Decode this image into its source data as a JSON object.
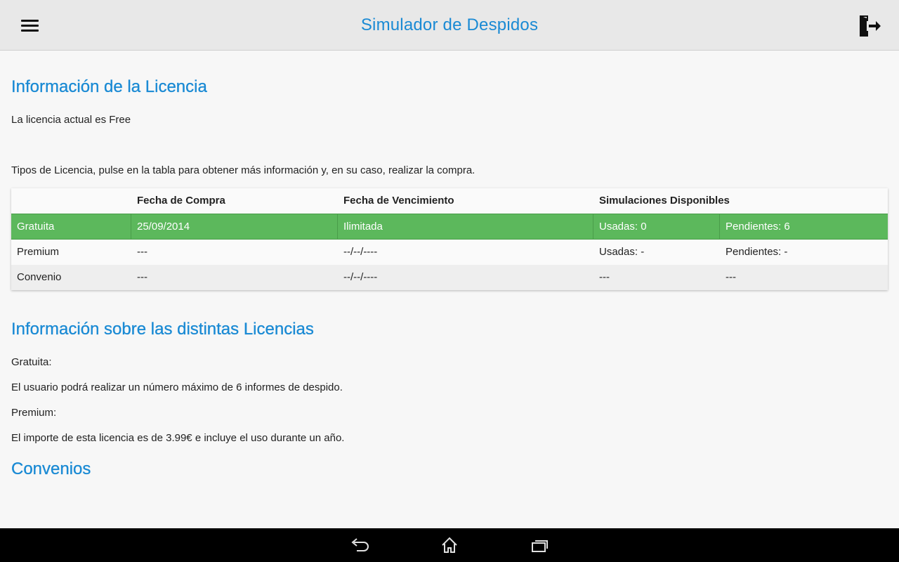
{
  "app": {
    "title": "Simulador de Despidos",
    "accent_color": "#1a8ad4",
    "menu_icon": "hamburger-menu-icon",
    "exit_icon": "exit-door-icon"
  },
  "license_info": {
    "heading": "Información de la Licencia",
    "current": "La licencia actual es Free",
    "instructions": "Tipos de Licencia, pulse en la tabla para obtener más información y, en su caso, realizar la compra."
  },
  "license_table": {
    "headers": [
      "",
      "Fecha de Compra",
      "Fecha de Vencimiento",
      "Simulaciones Disponibles",
      ""
    ],
    "rows": [
      {
        "name": "Gratuita",
        "purchase": "25/09/2014",
        "expiry": "Ilimitada",
        "used": "Usadas: 0",
        "pending": "Pendientes: 6",
        "selected": true,
        "highlight_color": "#5cb85c"
      },
      {
        "name": "Premium",
        "purchase": "---",
        "expiry": "--/--/----",
        "used": "Usadas: -",
        "pending": "Pendientes: -"
      },
      {
        "name": "Convenio",
        "purchase": "---",
        "expiry": "--/--/----",
        "used": "---",
        "pending": "---"
      }
    ]
  },
  "about": {
    "heading": "Información sobre las distintas Licencias",
    "free_label": "Gratuita:",
    "free_desc": "El usuario podrá realizar un número máximo de 6 informes de despido.",
    "premium_label": "Premium:",
    "premium_desc": "El importe de esta licencia es de 3.99€ e incluye el uso durante un año."
  },
  "convenios": {
    "heading": "Convenios"
  },
  "system_nav": {
    "back_icon": "back-icon",
    "home_icon": "home-icon",
    "recents_icon": "recent-apps-icon"
  }
}
